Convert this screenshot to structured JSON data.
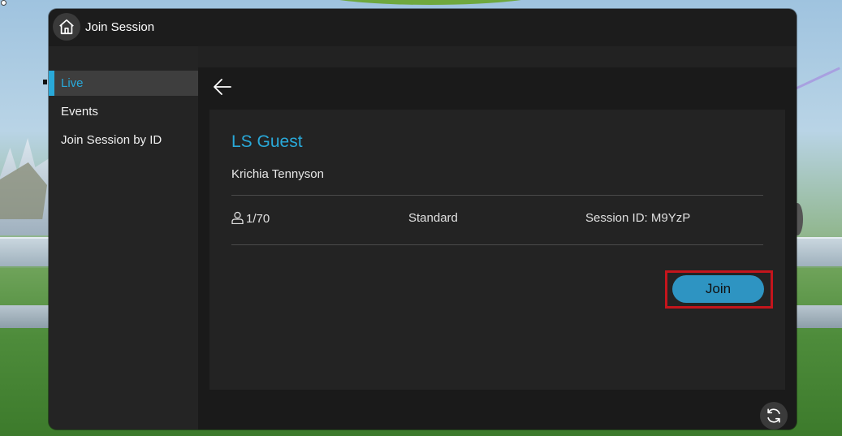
{
  "window": {
    "title": "Join Session"
  },
  "sidebar": {
    "items": [
      {
        "label": "Live",
        "active": true
      },
      {
        "label": "Events",
        "active": false
      },
      {
        "label": "Join Session by ID",
        "active": false
      }
    ]
  },
  "session": {
    "name": "LS Guest",
    "host": "Krichia Tennyson",
    "users": "1/70",
    "type": "Standard",
    "session_id": "Session ID: M9YzP"
  },
  "actions": {
    "join_label": "Join"
  },
  "colors": {
    "accent": "#29a9d9",
    "join_button": "#2e94c2",
    "highlight": "#c4151c",
    "panel": "#1e1e1e"
  },
  "icons": {
    "home": "home-icon",
    "back": "back-arrow-icon",
    "user": "user-icon",
    "refresh": "refresh-icon"
  }
}
